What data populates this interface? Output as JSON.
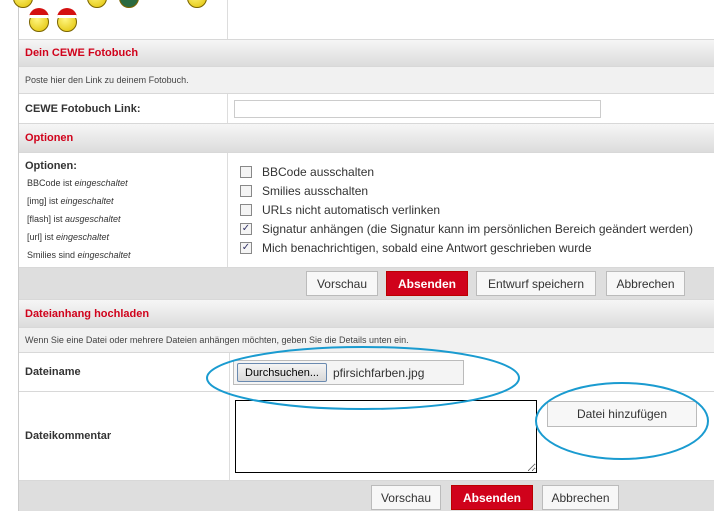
{
  "fotobuch": {
    "title": "Dein CEWE Fotobuch",
    "description": "Poste hier den Link zu deinem Fotobuch.",
    "link_label": "CEWE Fotobuch Link:",
    "link_value": ""
  },
  "options": {
    "title": "Optionen",
    "heading": "Optionen:",
    "status": [
      {
        "prefix": "BBCode ist ",
        "state": "eingeschaltet"
      },
      {
        "prefix": "[img] ist ",
        "state": "eingeschaltet"
      },
      {
        "prefix": "[flash] ist ",
        "state": "ausgeschaltet"
      },
      {
        "prefix": "[url] ist ",
        "state": "eingeschaltet"
      },
      {
        "prefix": "Smilies sind ",
        "state": "eingeschaltet"
      }
    ],
    "checkboxes": [
      {
        "label": "BBCode ausschalten",
        "checked": false
      },
      {
        "label": "Smilies ausschalten",
        "checked": false
      },
      {
        "label": "URLs nicht automatisch verlinken",
        "checked": false
      },
      {
        "label": "Signatur anhängen (die Signatur kann im persönlichen Bereich geändert werden)",
        "checked": true
      },
      {
        "label": "Mich benachrichtigen, sobald eine Antwort geschrieben wurde",
        "checked": true
      }
    ]
  },
  "buttons1": {
    "preview": "Vorschau",
    "submit": "Absenden",
    "draft": "Entwurf speichern",
    "cancel": "Abbrechen"
  },
  "attach": {
    "title": "Dateianhang hochladen",
    "description": "Wenn Sie eine Datei oder mehrere Dateien anhängen möchten, geben Sie die Details unten ein.",
    "filename_label": "Dateiname",
    "browse": "Durchsuchen...",
    "filename": "pfirsichfarben.jpg",
    "comment_label": "Dateikommentar",
    "comment_value": "",
    "add_file": "Datei hinzufügen"
  },
  "buttons2": {
    "preview": "Vorschau",
    "submit": "Absenden",
    "cancel": "Abbrechen"
  },
  "colors": {
    "accent": "#d0021b",
    "annotation": "#1a9bd0"
  }
}
